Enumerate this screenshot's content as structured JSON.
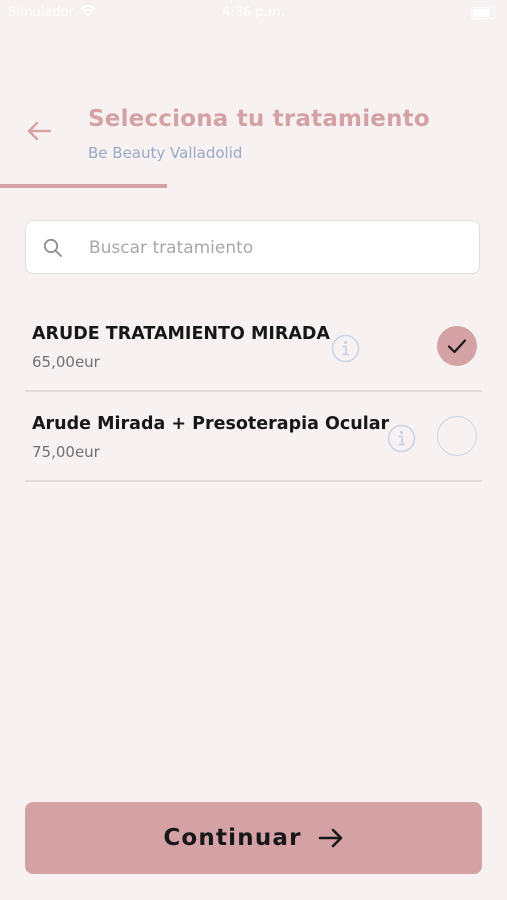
{
  "status_bar": {
    "carrier": "Simulador",
    "time": "4:36 p.m."
  },
  "header": {
    "title": "Selecciona tu tratamiento",
    "subtitle": "Be Beauty Valladolid",
    "progress": 0.33
  },
  "search": {
    "placeholder": "Buscar tratamiento",
    "value": ""
  },
  "treatments": [
    {
      "name": "ARUDE TRATAMIENTO MIRADA",
      "price": "65,00eur",
      "selected": true
    },
    {
      "name": "Arude Mirada + Presoterapia Ocular",
      "price": "75,00eur",
      "selected": false
    }
  ],
  "footer": {
    "continue_label": "Continuar"
  },
  "colors": {
    "accent": "#d4a2a4",
    "background": "#f7f2f1",
    "subtitle": "#9aa9c8",
    "info_icon": "#c9d3e8"
  },
  "icons": {
    "back": "arrow-left-icon",
    "search": "search-icon",
    "info": "info-icon",
    "check": "check-icon",
    "continue": "arrow-right-icon"
  }
}
